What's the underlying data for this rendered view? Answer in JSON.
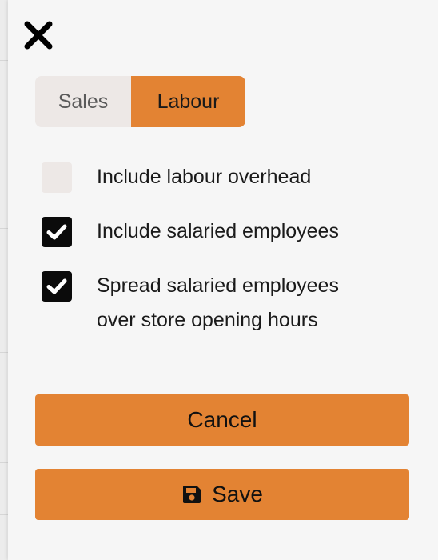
{
  "panel": {
    "close_icon": "close-icon",
    "tabs": [
      {
        "label": "Sales",
        "active": false
      },
      {
        "label": "Labour",
        "active": true
      }
    ],
    "options": [
      {
        "label": "Include labour overhead",
        "checked": false
      },
      {
        "label": "Include salaried employees",
        "checked": true
      },
      {
        "label": "Spread salaried employees over store opening hours",
        "checked": true
      }
    ],
    "cancel_label": "Cancel",
    "save_label": "Save",
    "save_icon": "floppy-disk-icon"
  },
  "colors": {
    "accent": "#e38333",
    "inactive_tab": "#ede8e6",
    "checkbox_checked": "#0b0b0b",
    "panel_bg": "#f6f6f6"
  }
}
